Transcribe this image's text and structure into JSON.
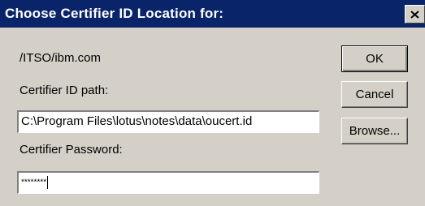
{
  "window": {
    "title": "Choose Certifier ID Location for:",
    "close_icon": "close-icon"
  },
  "main": {
    "org_name": "/ITSO/ibm.com",
    "path_label": "Certifier ID path:",
    "path_value": "C:\\Program Files\\lotus\\notes\\data\\oucert.id",
    "password_label": "Certifier Password:",
    "password_masked": "********"
  },
  "buttons": {
    "ok": "OK",
    "cancel": "Cancel",
    "browse": "Browse..."
  },
  "colors": {
    "titlebar": "#0a246a",
    "dialog_bg": "#d4d0c8"
  }
}
